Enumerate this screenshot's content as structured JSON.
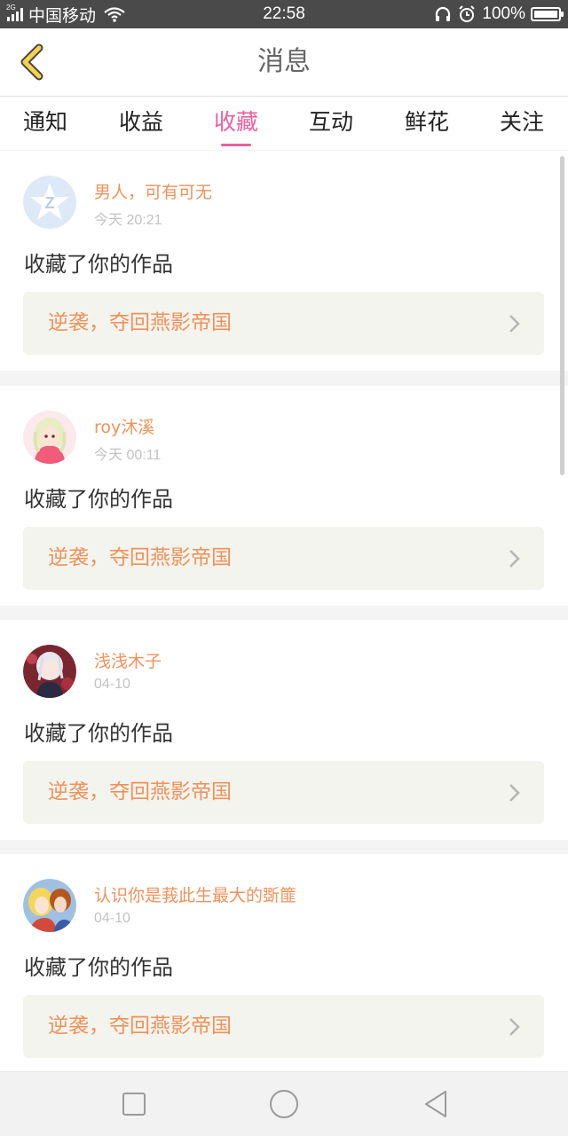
{
  "status_bar": {
    "network_label": "2G",
    "carrier": "中国移动",
    "time": "22:58",
    "battery_text": "100%",
    "battery_level": 1.0,
    "icons": [
      "signal-icon",
      "wifi-icon",
      "headphones-icon",
      "alarm-icon",
      "battery-icon"
    ]
  },
  "header": {
    "title": "消息",
    "back_icon": "chevron-left-icon"
  },
  "tabs": [
    {
      "label": "通知",
      "active": false
    },
    {
      "label": "收益",
      "active": false
    },
    {
      "label": "收藏",
      "active": true
    },
    {
      "label": "互动",
      "active": false
    },
    {
      "label": "鲜花",
      "active": false
    },
    {
      "label": "关注",
      "active": false
    }
  ],
  "items": [
    {
      "user": "男人，可有可无",
      "time": "今天 20:21",
      "action": "收藏了你的作品",
      "work": "逆袭，夺回燕影帝国"
    },
    {
      "user": "roy沐溪",
      "time": "今天 00:11",
      "action": "收藏了你的作品",
      "work": "逆袭，夺回燕影帝国"
    },
    {
      "user": "浅浅木子",
      "time": "04-10",
      "action": "收藏了你的作品",
      "work": "逆袭，夺回燕影帝国"
    },
    {
      "user": "认识你是莪此生最大的斲篚",
      "time": "04-10",
      "action": "收藏了你的作品",
      "work": "逆袭，夺回燕影帝国"
    }
  ],
  "colors": {
    "accent": "#ec5f9c",
    "highlight": "#f0925a",
    "back_arrow": "#f5d34a",
    "card_bg": "#f4f4ee"
  },
  "nav": [
    "recent-apps-icon",
    "home-icon",
    "back-icon"
  ]
}
